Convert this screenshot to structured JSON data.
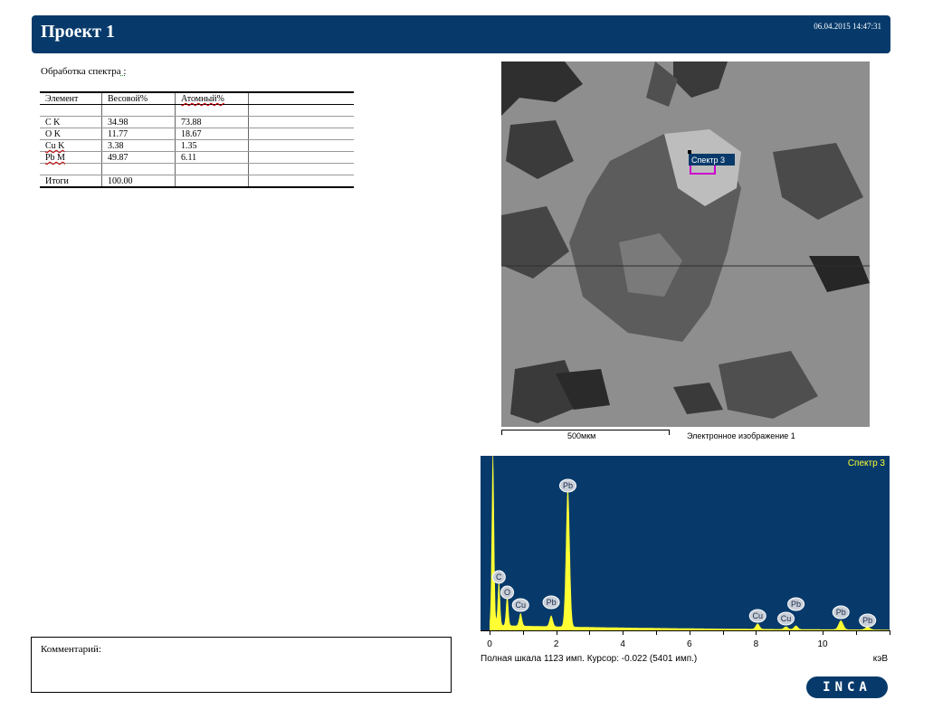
{
  "header": {
    "title": "Проект 1",
    "datetime": "06.04.2015 14:47:31"
  },
  "section": {
    "label": "Обработка спектра",
    "suffix": " :"
  },
  "table": {
    "columns": [
      "Элемент",
      "Весовой%",
      "Атомный%",
      ""
    ],
    "rows": [
      [
        "",
        "",
        "",
        ""
      ],
      [
        "C K",
        "34.98",
        "73.88",
        ""
      ],
      [
        "O K",
        "11.77",
        "18.67",
        ""
      ],
      [
        "Cu K",
        "3.38",
        "1.35",
        ""
      ],
      [
        "Pb M",
        "49.87",
        "6.11",
        ""
      ],
      [
        "",
        "",
        "",
        ""
      ],
      [
        "Итоги",
        "100.00",
        "",
        ""
      ]
    ]
  },
  "image": {
    "marker_label": "Спектр 3",
    "scale_label": "500мкм",
    "caption": "Электронное изображение 1",
    "marker_color": "#cc00cc"
  },
  "spectrum": {
    "label": "Спектр 3",
    "background": "#073a6b",
    "trace_color": "#ffff33",
    "peaks": [
      {
        "label": "C",
        "kev": 0.28
      },
      {
        "label": "O",
        "kev": 0.53
      },
      {
        "label": "Cu",
        "kev": 0.93
      },
      {
        "label": "Pb",
        "kev": 1.85
      },
      {
        "label": "Pb",
        "kev": 2.35
      },
      {
        "label": "Cu",
        "kev": 8.05
      },
      {
        "label": "Cu",
        "kev": 8.9
      },
      {
        "label": "Pb",
        "kev": 9.2
      },
      {
        "label": "Pb",
        "kev": 10.55
      },
      {
        "label": "Pb",
        "kev": 11.35
      }
    ],
    "ticks": [
      "0",
      "2",
      "4",
      "6",
      "8",
      "10"
    ],
    "footer": "Полная шкала 1123 имп. Курсор: -0.022  (5401 имп.)",
    "unit": "кэВ"
  },
  "comment": {
    "label": "Комментарий:"
  },
  "logo": {
    "text": "INCA"
  }
}
